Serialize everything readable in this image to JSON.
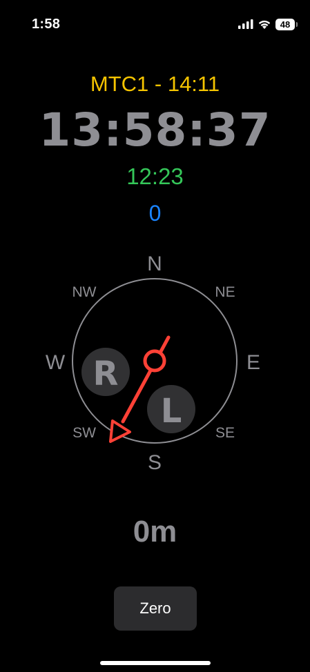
{
  "status_bar": {
    "time": "1:58",
    "battery_level": "48",
    "icons": [
      "cellular-signal-icon",
      "wifi-icon",
      "battery-icon"
    ]
  },
  "timer": {
    "title": "MTC1 - 14:11",
    "clock": "13:58:37",
    "sub_time": "12:23",
    "counter": "0"
  },
  "compass": {
    "north": "N",
    "north_east": "NE",
    "east": "E",
    "south_east": "SE",
    "south": "S",
    "south_west": "SW",
    "west": "W",
    "north_west": "NW",
    "right_marker": "R",
    "left_marker": "L",
    "arrow_color": "#ff4136"
  },
  "distance": "0m",
  "buttons": {
    "zero": "Zero"
  },
  "colors": {
    "title": "#f5c400",
    "clock": "#8e8e93",
    "sub_time": "#35c759",
    "counter": "#1a84ff",
    "arrow": "#ff4136"
  }
}
